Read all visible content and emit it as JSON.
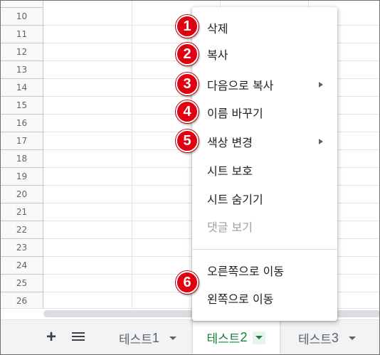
{
  "grid": {
    "rows": [
      "10",
      "11",
      "12",
      "13",
      "14",
      "15",
      "16",
      "17",
      "18",
      "19",
      "20",
      "21",
      "22",
      "23",
      "24",
      "25",
      "26"
    ]
  },
  "tabbar": {
    "add_label": "+",
    "tabs": [
      {
        "label": "테스트",
        "num": "1"
      },
      {
        "label": "테스트",
        "num": "2"
      },
      {
        "label": "테스트",
        "num": "3"
      }
    ]
  },
  "menu": {
    "items": [
      {
        "label": "삭제"
      },
      {
        "label": "복사"
      },
      {
        "label": "다음으로 복사"
      },
      {
        "label": "이름 바꾸기"
      },
      {
        "label": "색상 변경"
      },
      {
        "label": "시트 보호"
      },
      {
        "label": "시트 숨기기"
      },
      {
        "label": "댓글 보기"
      },
      {
        "label": "오른쪽으로 이동"
      },
      {
        "label": "왼쪽으로 이동"
      }
    ],
    "badges": [
      "1",
      "2",
      "3",
      "4",
      "5",
      "6"
    ]
  },
  "colors": {
    "active_tab": "#188038",
    "badge": "#e0000f",
    "disabled_text": "#9aa0a6"
  }
}
